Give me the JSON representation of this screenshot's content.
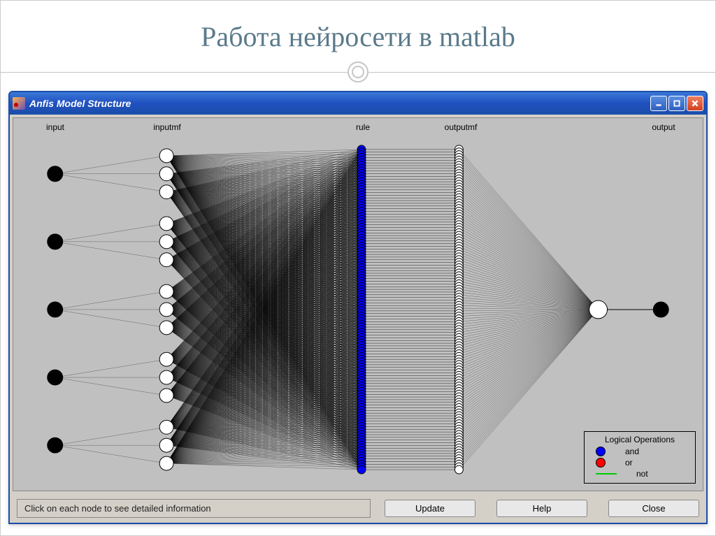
{
  "slide": {
    "title": "Работа нейросети в matlab"
  },
  "window": {
    "title": "Anfis Model Structure",
    "status": "Click on each node to see detailed information",
    "buttons": {
      "update": "Update",
      "help": "Help",
      "close": "Close"
    }
  },
  "layers": {
    "input": "input",
    "inputmf": "inputmf",
    "rule": "rule",
    "outputmf": "outputmf",
    "output": "output"
  },
  "legend": {
    "title": "Logical Operations",
    "and": "and",
    "or": "or",
    "not": "not"
  },
  "colors": {
    "and": "#0000ff",
    "or": "#ff0000",
    "not": "#00cc00"
  }
}
